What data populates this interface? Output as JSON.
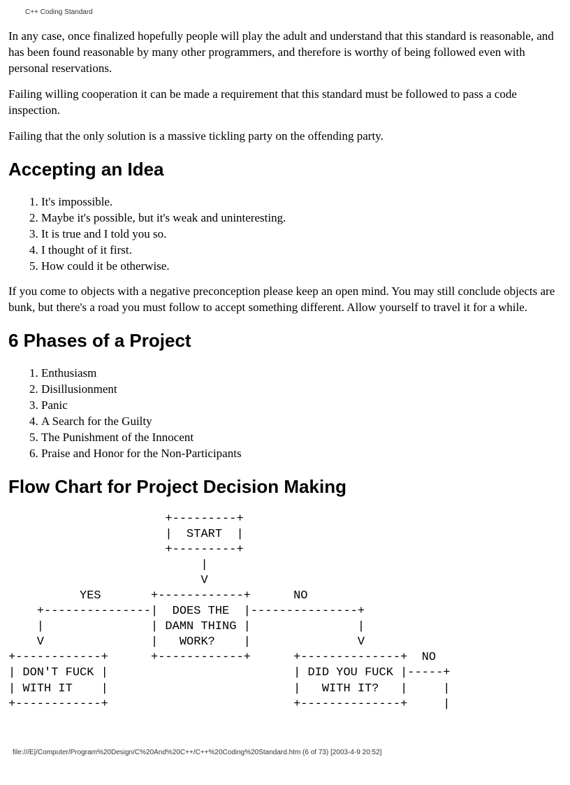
{
  "header": "C++ Coding Standard",
  "paragraphs": {
    "p1": "In any case, once finalized hopefully people will play the adult and understand that this standard is reasonable, and has been found reasonable by many other programmers, and therefore is worthy of being followed even with personal reservations.",
    "p2": "Failing willing cooperation it can be made a requirement that this standard must be followed to pass a code inspection.",
    "p3": "Failing that the only solution is a massive tickling party on the offending party.",
    "p4": "If you come to objects with a negative preconception please keep an open mind. You may still conclude objects are bunk, but there's a road you must follow to accept something different. Allow yourself to travel it for a while."
  },
  "headings": {
    "h1": "Accepting an Idea",
    "h2": "6 Phases of a Project",
    "h3": "Flow Chart for Project Decision Making"
  },
  "list1": {
    "i1": "It's impossible.",
    "i2": "Maybe it's possible, but it's weak and uninteresting.",
    "i3": "It is true and I told you so.",
    "i4": "I thought of it first.",
    "i5": "How could it be otherwise."
  },
  "list2": {
    "i1": "Enthusiasm",
    "i2": "Disillusionment",
    "i3": "Panic",
    "i4": "A Search for the Guilty",
    "i5": "The Punishment of the Innocent",
    "i6": "Praise and Honor for the Non-Participants"
  },
  "flowchart": "                      +---------+\n                      |  START  |\n                      +---------+\n                           |\n                           V\n          YES       +------------+      NO\n    +---------------|  DOES THE  |---------------+\n    |               | DAMN THING |               |\n    V               |   WORK?    |               V\n+------------+      +------------+      +--------------+  NO\n| DON'T FUCK |                          | DID YOU FUCK |-----+\n| WITH IT    |                          |   WITH IT?   |     |\n+------------+                          +--------------+     |",
  "footer": "file:///E|/Computer/Program%20Design/C%20And%20C++/C++%20Coding%20Standard.htm (6 of 73) [2003-4-9 20:52]"
}
